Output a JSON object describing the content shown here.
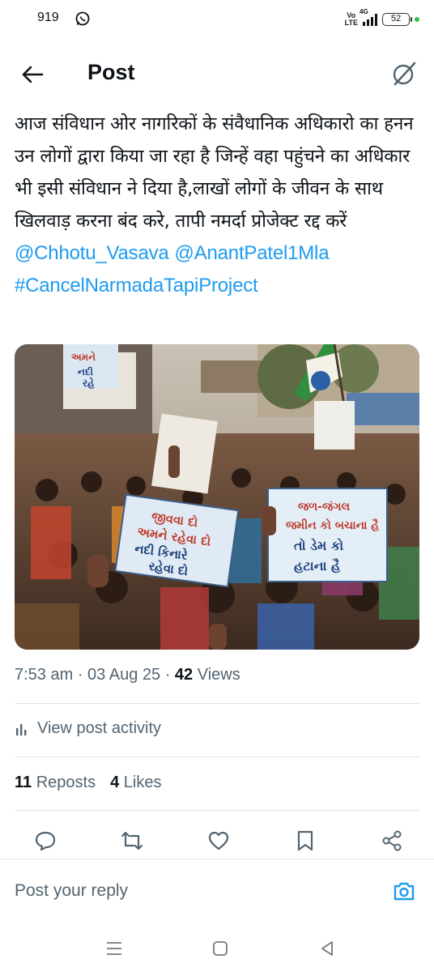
{
  "status_bar": {
    "time": "919",
    "network_label": "4G",
    "volte_label": "Vo\nLTE",
    "battery": "52",
    "accent": "#2fbf4a"
  },
  "header": {
    "title": "Post",
    "back_icon": "arrow-left-icon",
    "grok_icon": "grok-icon"
  },
  "post": {
    "text": "आज संविधान ओर नागरिकों के संवैधानिक अधिकारो का हनन उन लोगों द्वारा किया जा रहा है जिन्हें वहा पहुंचने का अधिकार भी इसी संविधान ने दिया है,लाखों लोगों के जीवन के साथ खिलवाड़ करना बंद करे, तापी नमर्दा प्रोजेक्ट रद्द करें",
    "mentions": [
      "@Chhotu_Vasava",
      "@AnantPatel1Mla"
    ],
    "hashtag": "#CancelNarmadaTapiProject",
    "link_color": "#1d9bf0",
    "media": {
      "signs": [
        "અમને નદી રહે...",
        "જીવવા દો અમને રહેવા દો નદી કિનારે રહેવા દો",
        "જળ-જંગલ જમીન કો બચાના હૈ તો ડેમ કો હટાના હૈ"
      ]
    }
  },
  "meta": {
    "time": "7:53 am",
    "sep1": " · ",
    "date": "03 Aug 25",
    "sep2": " · ",
    "views_count": "42",
    "views_label": " Views"
  },
  "activity": {
    "label": "View post activity",
    "icon": "bar-chart-icon"
  },
  "counts": {
    "reposts_count": "11",
    "reposts_label": " Reposts",
    "likes_count": "4",
    "likes_label": " Likes"
  },
  "actions": {
    "icons": [
      "reply-icon",
      "repost-icon",
      "like-icon",
      "bookmark-icon",
      "share-icon"
    ]
  },
  "reply": {
    "placeholder": "Post your reply",
    "camera_icon": "camera-icon"
  },
  "nav": {
    "icons": [
      "recents-icon",
      "home-icon",
      "back-triangle-icon"
    ]
  }
}
